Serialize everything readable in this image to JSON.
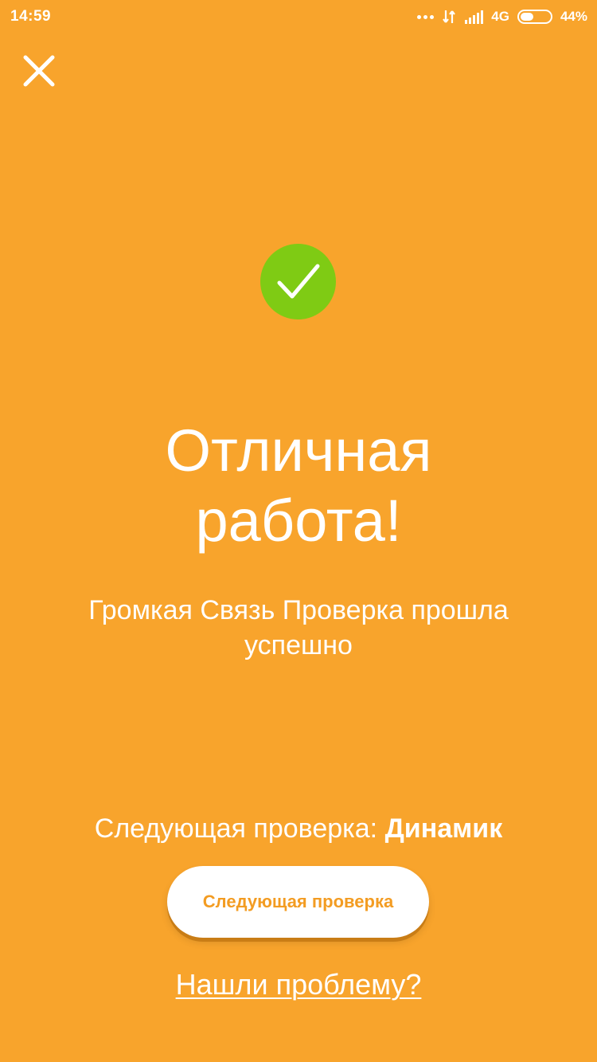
{
  "status_bar": {
    "time": "14:59",
    "network": "4G",
    "battery_percent": "44%",
    "battery_level": 0.44,
    "icons": [
      "more-dots-icon",
      "data-arrows-icon",
      "signal-icon",
      "battery-icon"
    ]
  },
  "close": {
    "icon": "close-icon"
  },
  "success": {
    "icon": "checkmark-icon",
    "badge_color": "#7FCB14"
  },
  "headline": {
    "line1": "Отличная",
    "line2": "работа!"
  },
  "subtitle": {
    "line1": "Громкая Связь Проверка прошла",
    "line2": "успешно"
  },
  "next_check": {
    "label": "Следующая проверка: ",
    "name": "Динамик"
  },
  "next_button": {
    "label": "Следующая проверка"
  },
  "report_link": {
    "label": "Нашли проблему?"
  },
  "colors": {
    "background": "#F8A42C",
    "button_text": "#F39C22",
    "text": "#FFFFFF"
  }
}
